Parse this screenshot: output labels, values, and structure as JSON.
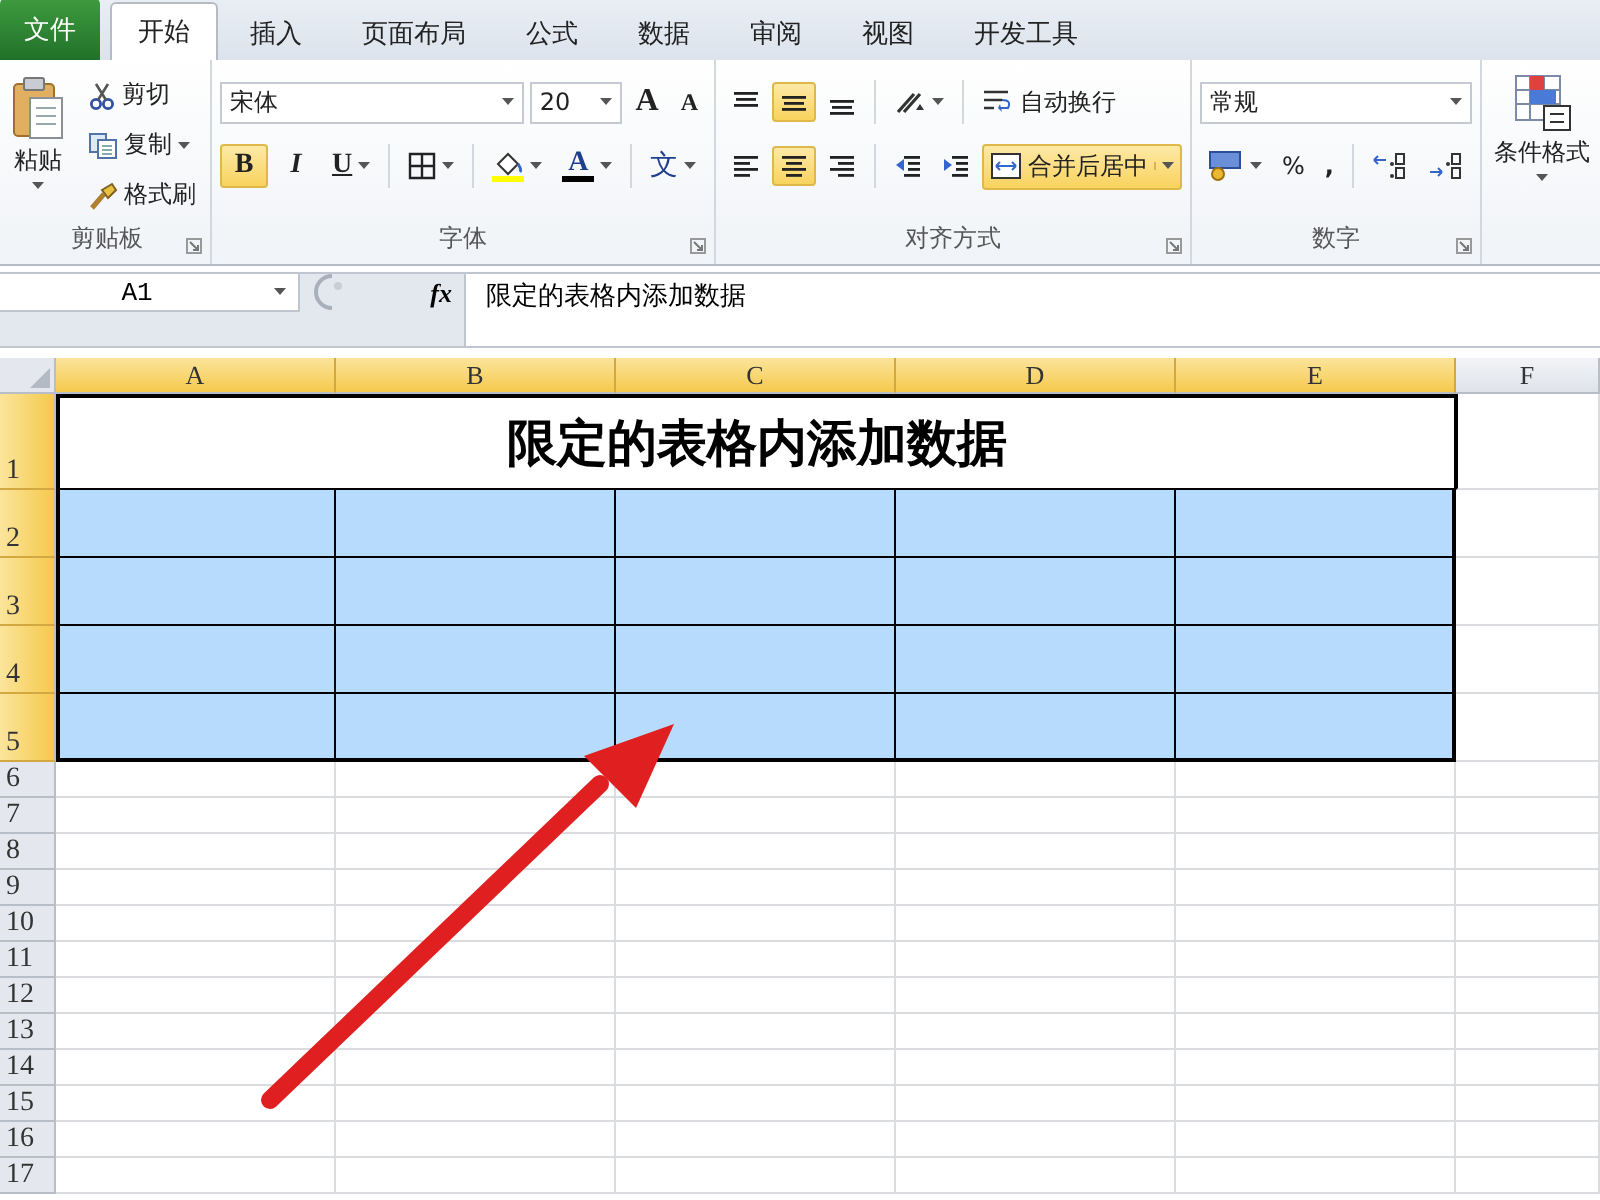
{
  "tabs": [
    {
      "label": "文件",
      "kind": "file",
      "selected": false
    },
    {
      "label": "开始",
      "kind": "tab",
      "selected": true
    },
    {
      "label": "插入",
      "kind": "tab",
      "selected": false
    },
    {
      "label": "页面布局",
      "kind": "tab",
      "selected": false
    },
    {
      "label": "公式",
      "kind": "tab",
      "selected": false
    },
    {
      "label": "数据",
      "kind": "tab",
      "selected": false
    },
    {
      "label": "审阅",
      "kind": "tab",
      "selected": false
    },
    {
      "label": "视图",
      "kind": "tab",
      "selected": false
    },
    {
      "label": "开发工具",
      "kind": "tab",
      "selected": false
    }
  ],
  "ribbon": {
    "clipboard": {
      "label": "剪贴板",
      "paste": "粘贴",
      "cut": "剪切",
      "copy": "复制",
      "format_painter": "格式刷"
    },
    "font": {
      "label": "字体",
      "font_name": "宋体",
      "font_size": "20",
      "grow": "A",
      "shrink": "A",
      "bold": {
        "glyph": "B",
        "on": true
      },
      "italic": {
        "glyph": "I",
        "on": false
      },
      "underline": {
        "glyph": "U",
        "on": false
      },
      "font_color": "A",
      "phonetic": "文"
    },
    "alignment": {
      "label": "对齐方式",
      "vertical": [
        {
          "kind": "top",
          "selected": false
        },
        {
          "kind": "middle",
          "selected": true
        },
        {
          "kind": "bottom",
          "selected": false
        }
      ],
      "horizontal": [
        {
          "kind": "left",
          "selected": false
        },
        {
          "kind": "center",
          "selected": true
        },
        {
          "kind": "right",
          "selected": false
        }
      ],
      "wrap_text": "自动换行",
      "merge_center": {
        "label": "合并后居中",
        "on": true
      }
    },
    "number": {
      "label": "数字",
      "format": "常规",
      "percent": "%",
      "comma": ","
    },
    "styles": {
      "conditional_format": "条件格式"
    }
  },
  "formula_bar": {
    "name_box": "A1",
    "fx": "fx",
    "formula": "限定的表格内添加数据"
  },
  "sheet": {
    "columns": [
      {
        "label": "A",
        "selected": true
      },
      {
        "label": "B",
        "selected": true
      },
      {
        "label": "C",
        "selected": true
      },
      {
        "label": "D",
        "selected": true
      },
      {
        "label": "E",
        "selected": true
      },
      {
        "label": "F",
        "selected": false
      }
    ],
    "rows": [
      {
        "label": "1",
        "kind": "title",
        "selected": true,
        "text": "限定的表格内添加数据"
      },
      {
        "label": "2",
        "kind": "data",
        "selected": true
      },
      {
        "label": "3",
        "kind": "data",
        "selected": true
      },
      {
        "label": "4",
        "kind": "data",
        "selected": true
      },
      {
        "label": "5",
        "kind": "data",
        "selected": true
      },
      {
        "label": "6",
        "kind": "empty",
        "selected": false
      },
      {
        "label": "7",
        "kind": "empty",
        "selected": false
      },
      {
        "label": "8",
        "kind": "empty",
        "selected": false
      },
      {
        "label": "9",
        "kind": "empty",
        "selected": false
      },
      {
        "label": "10",
        "kind": "empty",
        "selected": false
      },
      {
        "label": "11",
        "kind": "empty",
        "selected": false
      },
      {
        "label": "12",
        "kind": "empty",
        "selected": false
      },
      {
        "label": "13",
        "kind": "empty",
        "selected": false
      },
      {
        "label": "14",
        "kind": "empty",
        "selected": false
      },
      {
        "label": "15",
        "kind": "empty",
        "selected": false
      },
      {
        "label": "16",
        "kind": "empty",
        "selected": false
      },
      {
        "label": "17",
        "kind": "empty",
        "selected": false
      }
    ]
  }
}
